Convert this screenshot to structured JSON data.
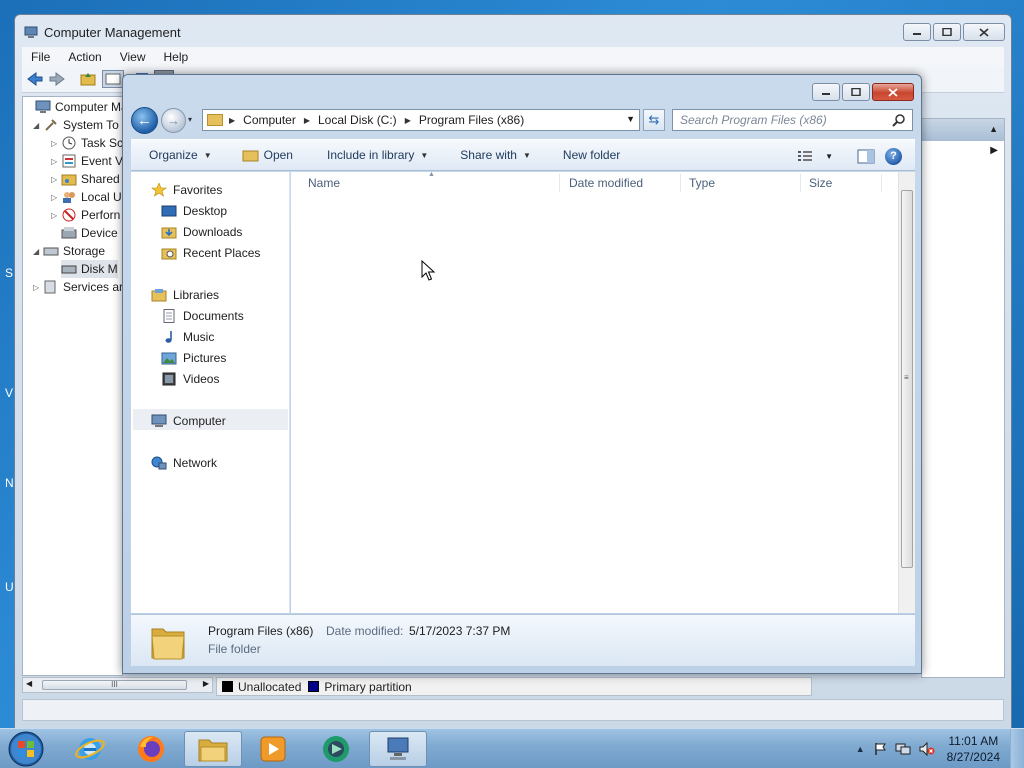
{
  "desktop_fragments": [
    "S",
    "V",
    "N",
    "U"
  ],
  "computer_management": {
    "title": "Computer Management",
    "menu": [
      "File",
      "Action",
      "View",
      "Help"
    ],
    "tree": [
      {
        "label": "Computer Ma",
        "icon": "computer-icon"
      },
      {
        "label": "System To",
        "icon": "tools-icon"
      },
      {
        "label": "Task Sc",
        "icon": "clock-icon"
      },
      {
        "label": "Event V",
        "icon": "event-viewer-icon"
      },
      {
        "label": "Shared",
        "icon": "shared-folder-icon"
      },
      {
        "label": "Local U",
        "icon": "users-icon"
      },
      {
        "label": "Perforn",
        "icon": "performance-icon"
      },
      {
        "label": "Device",
        "icon": "device-manager-icon"
      },
      {
        "label": "Storage",
        "icon": "storage-icon"
      },
      {
        "label": "Disk M",
        "icon": "disk-icon"
      },
      {
        "label": "Services ar",
        "icon": "services-icon"
      }
    ],
    "legend": [
      {
        "label": "Unallocated",
        "color": "#000000"
      },
      {
        "label": "Primary partition",
        "color": "#00008b"
      }
    ],
    "hscroll_grip": "III"
  },
  "explorer": {
    "breadcrumb": [
      "Computer",
      "Local Disk (C:)",
      "Program Files (x86)"
    ],
    "search_placeholder": "Search Program Files (x86)",
    "commands": {
      "organize": "Organize",
      "open": "Open",
      "include_in_library": "Include in library",
      "share_with": "Share with",
      "new_folder": "New folder"
    },
    "nav": {
      "favorites": {
        "label": "Favorites",
        "items": [
          "Desktop",
          "Downloads",
          "Recent Places"
        ]
      },
      "libraries": {
        "label": "Libraries",
        "items": [
          "Documents",
          "Music",
          "Pictures",
          "Videos"
        ]
      },
      "computer": "Computer",
      "network": "Network"
    },
    "columns": [
      "Name",
      "Date modified",
      "Type",
      "Size"
    ],
    "details": {
      "name": "Program Files (x86)",
      "modified_label": "Date modified:",
      "modified_value": "5/17/2023 7:37 PM",
      "type": "File folder"
    }
  },
  "taskbar": {
    "apps": [
      "internet-explorer-icon",
      "firefox-icon",
      "file-explorer-icon",
      "media-player-icon",
      "app-icon",
      "computer-management-icon"
    ],
    "clock_time": "11:01 AM",
    "clock_date": "8/27/2024"
  }
}
